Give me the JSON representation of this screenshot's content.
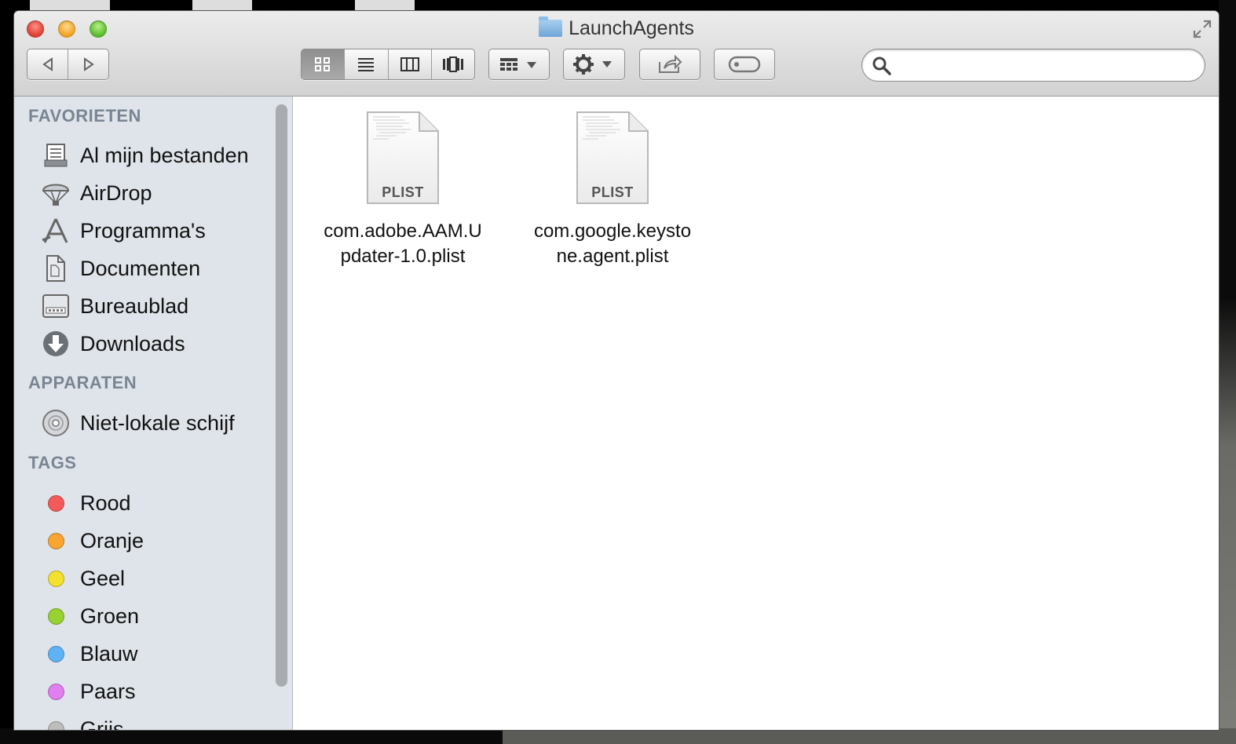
{
  "window": {
    "title": "LaunchAgents",
    "title_icon": "folder-icon"
  },
  "toolbar": {
    "back": "chevron-left-icon",
    "forward": "chevron-right-icon",
    "views": [
      "icon-view-icon",
      "list-view-icon",
      "column-view-icon",
      "coverflow-view-icon"
    ],
    "active_view": 0,
    "arrange": "arrange-icon",
    "action": "gear-icon",
    "share": "share-icon",
    "tags": "tag-icon",
    "search": {
      "placeholder": "",
      "value": ""
    }
  },
  "sidebar": {
    "sections": [
      {
        "title": "FAVORIETEN",
        "items": [
          {
            "label": "Al mijn bestanden",
            "icon": "all-files-icon"
          },
          {
            "label": "AirDrop",
            "icon": "airdrop-icon"
          },
          {
            "label": "Programma's",
            "icon": "applications-icon"
          },
          {
            "label": "Documenten",
            "icon": "documents-icon"
          },
          {
            "label": "Bureaublad",
            "icon": "desktop-icon"
          },
          {
            "label": "Downloads",
            "icon": "downloads-icon"
          }
        ]
      },
      {
        "title": "APPARATEN",
        "items": [
          {
            "label": "Niet-lokale schijf",
            "icon": "disc-icon"
          }
        ]
      },
      {
        "title": "TAGS",
        "items": [
          {
            "label": "Rood",
            "color": "#f45a5a"
          },
          {
            "label": "Oranje",
            "color": "#f9a531"
          },
          {
            "label": "Geel",
            "color": "#f3e12d"
          },
          {
            "label": "Groen",
            "color": "#97d132"
          },
          {
            "label": "Blauw",
            "color": "#5fb3f5"
          },
          {
            "label": "Paars",
            "color": "#e07ff0"
          },
          {
            "label": "Grijs",
            "color": "#bdbdbd"
          }
        ]
      }
    ]
  },
  "files": [
    {
      "name_line1": "com.adobe.AAM.U",
      "name_line2": "pdater-1.0.plist",
      "type": "PLIST"
    },
    {
      "name_line1": "com.google.keysto",
      "name_line2": "ne.agent.plist",
      "type": "PLIST"
    }
  ]
}
